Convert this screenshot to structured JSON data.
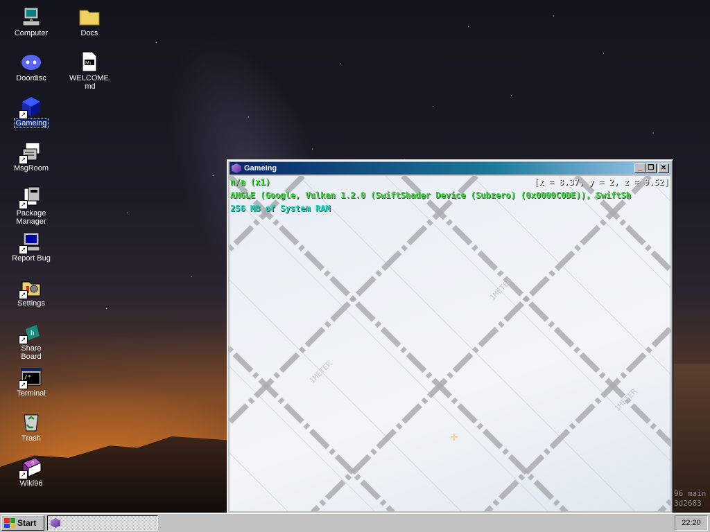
{
  "desktop": {
    "icons": [
      {
        "label": "Computer",
        "icon": "computer-icon"
      },
      {
        "label": "Docs",
        "icon": "folder-icon"
      },
      {
        "label": "Doordisc",
        "icon": "discord-icon"
      },
      {
        "label": "WELCOME.md",
        "icon": "markdown-file-icon"
      },
      {
        "label": "Gameing",
        "icon": "game-cube-icon"
      },
      {
        "label": "MsgRoom",
        "icon": "msgroom-icon"
      },
      {
        "label": "Package Manager",
        "icon": "package-icon"
      },
      {
        "label": "Report Bug",
        "icon": "report-bug-icon"
      },
      {
        "label": "Settings",
        "icon": "settings-icon"
      },
      {
        "label": "Share Board",
        "icon": "share-board-icon"
      },
      {
        "label": "Terminal",
        "icon": "terminal-icon"
      },
      {
        "label": "Trash",
        "icon": "recycle-bin-icon"
      },
      {
        "label": "Wiki96",
        "icon": "wiki-book-icon"
      }
    ],
    "selected": "Gameing",
    "background_text": [
      "96 main",
      "3d2683"
    ]
  },
  "window": {
    "title": "Gameing",
    "buttons": [
      "minimize",
      "restore",
      "close"
    ],
    "hud": {
      "line1": "n/a (x1)",
      "coords": "[x = 8.37, y = 2, z = 9.52]",
      "line2": "ANGLE (Google, Vulkan 1.2.0 (SwiftShader Device (Subzero) (0x0000C0DE)), SwiftSh",
      "line3": "256 MB of System RAM"
    },
    "grid_label": "1METER"
  },
  "taskbar": {
    "start_label": "Start",
    "clock": "22:20"
  },
  "colors": {
    "hud_green": "#33dd33",
    "hud_cyan": "#11d9c0",
    "selection": "#0a246a",
    "title_gradient_start": "#0a246a"
  }
}
